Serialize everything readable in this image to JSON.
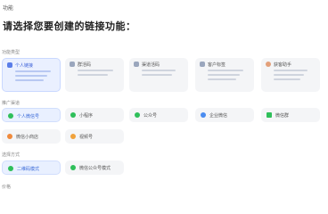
{
  "header": {
    "title": "功能"
  },
  "page": {
    "heading": "请选择您要创建的链接功能："
  },
  "sections": {
    "link_function": {
      "label": "功能类型"
    },
    "promotion": {
      "label": "推广渠道"
    },
    "mode": {
      "label": "选择方式"
    },
    "bottom": {
      "label": "价格"
    }
  },
  "function_cards": [
    {
      "title": "个人链接",
      "icon": "user-icon",
      "active": true
    },
    {
      "title": "群活码",
      "icon": "group-icon",
      "active": false
    },
    {
      "title": "渠道活码",
      "icon": "qrcode-icon",
      "active": false
    },
    {
      "title": "客户标签",
      "icon": "tag-icon",
      "active": false
    },
    {
      "title": "获客助手",
      "icon": "avatar-icon",
      "active": false
    }
  ],
  "promotion_chips": [
    {
      "label": "个人微信号",
      "icon": "wechat-icon",
      "color": "#2fbf5a",
      "active": true
    },
    {
      "label": "小程序",
      "icon": "miniprogram-icon",
      "color": "#2fbf5a",
      "active": false
    },
    {
      "label": "公众号",
      "icon": "official-account-icon",
      "color": "#2fbf5a",
      "active": false
    },
    {
      "label": "企业微信",
      "icon": "work-wechat-icon",
      "color": "#4a8cf0",
      "active": false
    },
    {
      "label": "微信群",
      "icon": "group-chat-icon",
      "color": "#2fbf5a",
      "active": false
    },
    {
      "label": "微信小商店",
      "icon": "shop-icon",
      "color": "#f08a3c",
      "active": false
    },
    {
      "label": "视频号",
      "icon": "video-icon",
      "color": "#f0a23c",
      "active": false
    }
  ],
  "mode_chips": [
    {
      "label": "二维码模式",
      "icon": "qr-mode-icon",
      "color": "#2fbf5a",
      "active": true
    },
    {
      "label": "微信公众号模式",
      "icon": "oa-mode-icon",
      "color": "#2fbf5a",
      "active": false
    }
  ]
}
